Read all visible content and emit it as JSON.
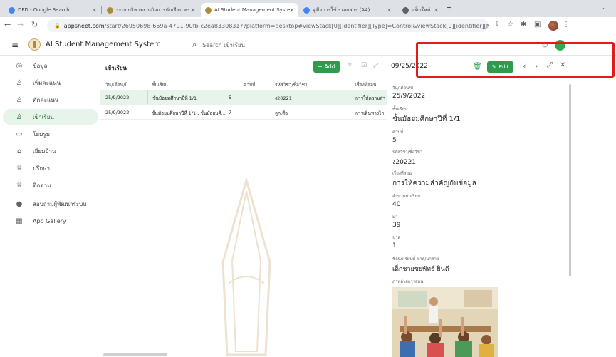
{
  "browser": {
    "tabs": [
      {
        "label": "DFD - Google Search",
        "fav": "#4285f4"
      },
      {
        "label": "ระบบบริหารงานกิจการนักเรียน ฮร",
        "fav": "#b08a3c"
      },
      {
        "label": "AI Student Management Syste",
        "fav": "#b08a3c",
        "active": true
      },
      {
        "label": "คู่มือการใช้ - เอกสาร (A4)",
        "fav": "#4285f4"
      },
      {
        "label": "แท็บใหม่",
        "fav": "#5f6368"
      }
    ],
    "url_host": "appsheet.com",
    "url_path": "/start/26950698-659a-4791-90fb-c2ea83308317?platform=desktop#viewStack[0][identifier][Type]=Control&viewStack[0][identifier][Name]=เข้าเรี..."
  },
  "app": {
    "title": "AI Student Management System",
    "search_placeholder": "Search เข้าเรียน",
    "accent": "#2e9c4a"
  },
  "nav": {
    "items": [
      {
        "label": "ข้อมูล",
        "icon": "◎"
      },
      {
        "label": "เพิ่มคะแนน",
        "icon": "♙+"
      },
      {
        "label": "ตัดคะแนน",
        "icon": "♙×"
      },
      {
        "label": "เข้าเรียน",
        "icon": "♙●",
        "active": true
      },
      {
        "label": "โฮมรูม",
        "icon": "▭"
      },
      {
        "label": "เยี่ยมบ้าน",
        "icon": "⌂"
      },
      {
        "label": "ปรึกษา",
        "icon": "♕"
      },
      {
        "label": "ติดตาม",
        "icon": "♕"
      },
      {
        "label": "สอบถามผู้พัฒนาระบบ",
        "icon": "●"
      },
      {
        "label": "App Gallery",
        "icon": "▦"
      }
    ]
  },
  "table": {
    "title": "เข้าเรียน",
    "add_label": "+ Add",
    "columns": [
      "วัน/เดือน/ปี",
      "ชั้นเรียน",
      "คาบที่",
      "รหัสวิชา/ชื่อวิชา",
      "เรื่องที่สอน"
    ],
    "rows": [
      [
        "25/9/2022",
        "ชั้นมัธยมศึกษาปีที่ 1/1",
        "5",
        "ง20221",
        "การให้ความสำ"
      ],
      [
        "25/9/2022",
        "ชั้นมัธยมศึกษาปีที่ 1/1 , ชั้นมัธยมศึ...",
        "7",
        "ลูกเสือ",
        "การเดินทางไก"
      ]
    ]
  },
  "detail": {
    "header_date": "09/25/2022",
    "edit_label": "Edit",
    "fields": [
      {
        "label": "วัน/เดือน/ปี",
        "value": "25/9/2022"
      },
      {
        "label": "ชั้นเรียน",
        "value": "ชั้นมัธยมศึกษาปีที่ 1/1"
      },
      {
        "label": "คาบที่",
        "value": "5"
      },
      {
        "label": "รหัสวิชา/ชื่อวิชา",
        "value": "ง20221"
      },
      {
        "label": "เรื่องที่สอน",
        "value": "การให้ความสำคัญกับข้อมูล"
      },
      {
        "label": "จำนวนนักเรียน",
        "value": "40"
      },
      {
        "label": "มา",
        "value": "39"
      },
      {
        "label": "ขาด",
        "value": "1"
      },
      {
        "label": "ชื่อนักเรียนที่ ขาด/มาสาย",
        "value": "เด็กชายชยพัทธ์  ยินดี"
      },
      {
        "label": "ภาพถ่ายการสอน",
        "value": ""
      }
    ]
  }
}
